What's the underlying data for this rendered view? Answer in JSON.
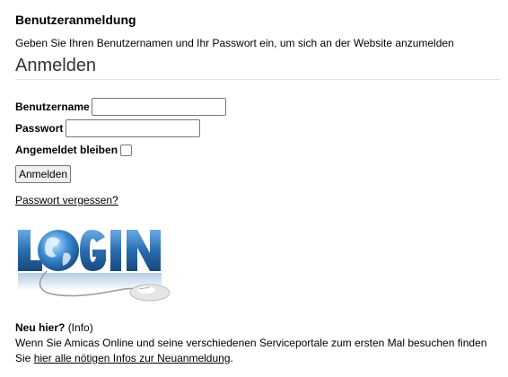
{
  "header": {
    "title": "Benutzeranmeldung",
    "intro": "Geben Sie Ihren Benutzernamen und Ihr Passwort ein, um sich an der Website anzumelden",
    "section_title": "Anmelden"
  },
  "form": {
    "username_label": "Benutzername",
    "username_value": "",
    "password_label": "Passwort",
    "password_value": "",
    "remember_label": "Angemeldet bleiben",
    "remember_checked": false,
    "submit_label": "Anmelden",
    "forgot_link": "Passwort vergessen?"
  },
  "logo": {
    "text": "LOGIN",
    "icon": "globe-mouse-login-logo",
    "colors": {
      "letters": "#2a6db0",
      "globe": "#3a8ad0",
      "cable": "#9a9a9a"
    }
  },
  "newuser": {
    "title": "Neu hier?",
    "info_tag": "(Info)",
    "line1": "Wenn Sie Amicas Online und seine verschiedenen Serviceportale zum ersten Mal besuchen finden",
    "line2_prefix": "Sie ",
    "line2_link": "hier alle nötigen Infos zur Neuanmeldung",
    "line2_suffix": "."
  }
}
